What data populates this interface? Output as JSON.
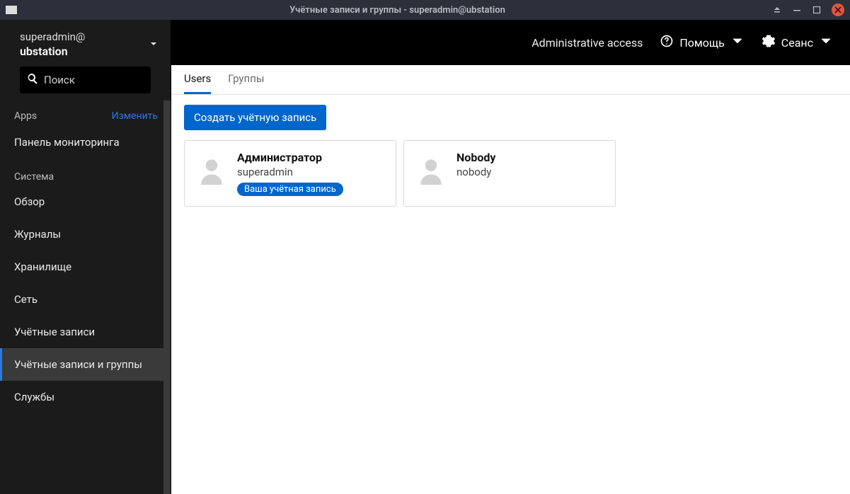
{
  "window": {
    "title": "Учётные записи и группы - superadmin@ubstation"
  },
  "host": {
    "user_at": "superadmin@",
    "host": "ubstation"
  },
  "search": {
    "placeholder": "Поиск"
  },
  "nav": {
    "apps_label": "Apps",
    "edit_label": "Изменить",
    "dashboard": "Панель мониторинга",
    "system_label": "Система",
    "items": [
      "Обзор",
      "Журналы",
      "Хранилище",
      "Сеть",
      "Учётные записи",
      "Учётные записи и группы",
      "Службы"
    ],
    "active_index": 5
  },
  "topbar": {
    "admin_access": "Administrative access",
    "help": "Помощь",
    "session": "Сеанс"
  },
  "tabs": {
    "users": "Users",
    "groups": "Группы",
    "active": "users"
  },
  "content": {
    "create_label": "Создать учётную запись",
    "users": [
      {
        "display": "Администратор",
        "login": "superadmin",
        "badge": "Ваша учётная запись"
      },
      {
        "display": "Nobody",
        "login": "nobody",
        "badge": null
      }
    ]
  }
}
